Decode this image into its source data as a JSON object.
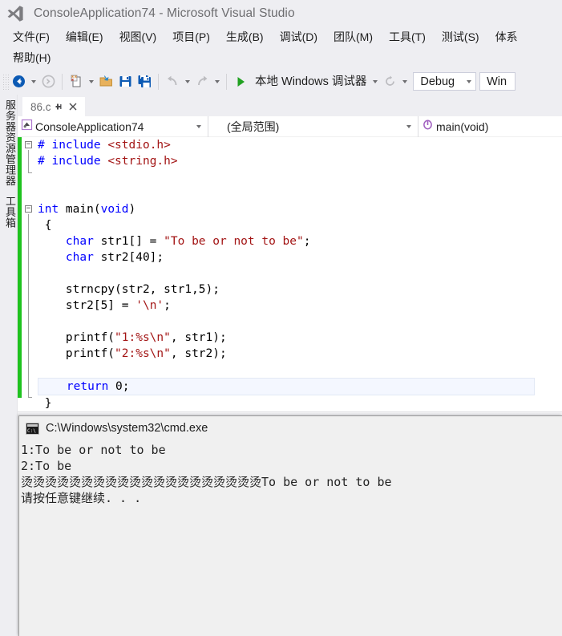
{
  "window": {
    "app_icon": "visual-studio-logo-icon",
    "title": "ConsoleApplication74 - Microsoft Visual Studio"
  },
  "menubar": {
    "items": [
      {
        "label": "文件(F)",
        "name": "menu-file"
      },
      {
        "label": "编辑(E)",
        "name": "menu-edit"
      },
      {
        "label": "视图(V)",
        "name": "menu-view"
      },
      {
        "label": "项目(P)",
        "name": "menu-project"
      },
      {
        "label": "生成(B)",
        "name": "menu-build"
      },
      {
        "label": "调试(D)",
        "name": "menu-debug"
      },
      {
        "label": "团队(M)",
        "name": "menu-team"
      },
      {
        "label": "工具(T)",
        "name": "menu-tools"
      },
      {
        "label": "测试(S)",
        "name": "menu-test"
      },
      {
        "label": "体系",
        "name": "menu-architecture"
      }
    ],
    "second_row": [
      {
        "label": "帮助(H)",
        "name": "menu-help"
      }
    ]
  },
  "toolbar": {
    "navigate_backward_icon": "back-arrow-icon",
    "navigate_forward_icon": "forward-arrow-icon",
    "new_item_icon": "new-file-icon",
    "open_icon": "open-folder-icon",
    "save_icon": "save-icon",
    "save_all_icon": "save-all-icon",
    "undo_icon": "undo-icon",
    "redo_icon": "redo-icon",
    "start_debug_icon": "play-triangle-icon",
    "start_debug_label": "本地 Windows 调试器",
    "refresh_icon": "refresh-icon",
    "configuration": "Debug",
    "platform": "Win",
    "dropdown_icon": "chevron-down-icon"
  },
  "left_dock": {
    "tabs": [
      {
        "label": "服务器资源管理器",
        "name": "dock-tab-server-explorer"
      },
      {
        "label": "工具箱",
        "name": "dock-tab-toolbox"
      }
    ]
  },
  "editor": {
    "tab": {
      "title": "86.c",
      "pin_icon": "pin-icon",
      "close_icon": "close-icon"
    },
    "navbar": {
      "project": "ConsoleApplication74",
      "project_icon": "project-icon",
      "scope": "(全局范围)",
      "member": "main(void)",
      "member_icon": "method-icon",
      "dropdown_icon": "chevron-down-icon"
    },
    "code_lines": [
      {
        "indent": 0,
        "fold": "open",
        "segments": [
          {
            "t": "# include ",
            "c": "pp"
          },
          {
            "t": "<stdio.h>",
            "c": "ppf"
          }
        ]
      },
      {
        "indent": 0,
        "fold": "bar",
        "segments": [
          {
            "t": "# include ",
            "c": "pp"
          },
          {
            "t": "<string.h>",
            "c": "ppf"
          }
        ]
      },
      {
        "indent": 0,
        "fold": "end",
        "segments": [
          {
            "t": "",
            "c": ""
          }
        ]
      },
      {
        "indent": 0,
        "fold": "none",
        "segments": [
          {
            "t": "",
            "c": ""
          }
        ]
      },
      {
        "indent": 0,
        "fold": "open",
        "segments": [
          {
            "t": "int",
            "c": "kw"
          },
          {
            "t": " main(",
            "c": ""
          },
          {
            "t": "void",
            "c": "kw"
          },
          {
            "t": ")",
            "c": ""
          }
        ]
      },
      {
        "indent": 1,
        "fold": "bar",
        "segments": [
          {
            "t": "{",
            "c": ""
          }
        ]
      },
      {
        "indent": 4,
        "fold": "bar",
        "segments": [
          {
            "t": "char",
            "c": "kw"
          },
          {
            "t": " str1[] = ",
            "c": ""
          },
          {
            "t": "\"To be or not to be\"",
            "c": "str"
          },
          {
            "t": ";",
            "c": ""
          }
        ]
      },
      {
        "indent": 4,
        "fold": "bar",
        "segments": [
          {
            "t": "char",
            "c": "kw"
          },
          {
            "t": " str2[40];",
            "c": ""
          }
        ]
      },
      {
        "indent": 0,
        "fold": "bar",
        "segments": [
          {
            "t": "",
            "c": ""
          }
        ]
      },
      {
        "indent": 4,
        "fold": "bar",
        "segments": [
          {
            "t": "strncpy(str2, str1,5);",
            "c": ""
          }
        ]
      },
      {
        "indent": 4,
        "fold": "bar",
        "segments": [
          {
            "t": "str2[5] = ",
            "c": ""
          },
          {
            "t": "'\\n'",
            "c": "str"
          },
          {
            "t": ";",
            "c": ""
          }
        ]
      },
      {
        "indent": 0,
        "fold": "bar",
        "segments": [
          {
            "t": "",
            "c": ""
          }
        ]
      },
      {
        "indent": 4,
        "fold": "bar",
        "segments": [
          {
            "t": "printf(",
            "c": ""
          },
          {
            "t": "\"1:%s\\n\"",
            "c": "str"
          },
          {
            "t": ", str1);",
            "c": ""
          }
        ]
      },
      {
        "indent": 4,
        "fold": "bar",
        "segments": [
          {
            "t": "printf(",
            "c": ""
          },
          {
            "t": "\"2:%s\\n\"",
            "c": "str"
          },
          {
            "t": ", str2);",
            "c": ""
          }
        ]
      },
      {
        "indent": 0,
        "fold": "bar",
        "segments": [
          {
            "t": "",
            "c": ""
          }
        ]
      },
      {
        "indent": 4,
        "fold": "bar",
        "selected": true,
        "segments": [
          {
            "t": "return",
            "c": "kw"
          },
          {
            "t": " 0;",
            "c": ""
          }
        ]
      },
      {
        "indent": 1,
        "fold": "end",
        "segments": [
          {
            "t": "}",
            "c": ""
          }
        ]
      }
    ]
  },
  "console": {
    "icon": "cmd-window-icon",
    "title": "C:\\Windows\\system32\\cmd.exe",
    "output_lines": [
      "1:To be or not to be",
      "2:To be",
      "烫烫烫烫烫烫烫烫烫烫烫烫烫烫烫烫烫烫烫烫To be or not to be",
      "请按任意键继续. . ."
    ]
  },
  "colors": {
    "chrome": "#eeeef2",
    "accent_blue": "#0078d7",
    "keyword": "#0000ff",
    "string": "#a31515",
    "change_bar_saved": "#1fc21f",
    "console_bg": "#f0f0f0",
    "play_green": "#21a121"
  }
}
